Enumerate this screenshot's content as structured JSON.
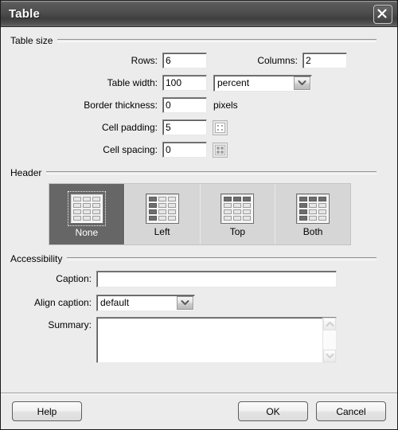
{
  "window": {
    "title": "Table",
    "close_icon": "close-icon"
  },
  "groups": {
    "table_size": {
      "title": "Table size",
      "rows_label": "Rows:",
      "rows_value": "6",
      "columns_label": "Columns:",
      "columns_value": "2",
      "table_width_label": "Table width:",
      "table_width_value": "100",
      "table_width_unit": "percent",
      "border_thickness_label": "Border thickness:",
      "border_thickness_value": "0",
      "border_thickness_unit": "pixels",
      "cell_padding_label": "Cell padding:",
      "cell_padding_value": "5",
      "cell_spacing_label": "Cell spacing:",
      "cell_spacing_value": "0"
    },
    "header": {
      "title": "Header",
      "options": [
        {
          "label": "None",
          "selected": true
        },
        {
          "label": "Left",
          "selected": false
        },
        {
          "label": "Top",
          "selected": false
        },
        {
          "label": "Both",
          "selected": false
        }
      ]
    },
    "accessibility": {
      "title": "Accessibility",
      "caption_label": "Caption:",
      "caption_value": "",
      "align_caption_label": "Align caption:",
      "align_caption_value": "default",
      "summary_label": "Summary:",
      "summary_value": ""
    }
  },
  "footer": {
    "help_label": "Help",
    "ok_label": "OK",
    "cancel_label": "Cancel"
  },
  "colors": {
    "dialog_background": "#ececec",
    "titlebar": "#4e4e4e",
    "selected_option": "#666666",
    "field_background": "#ffffff"
  }
}
